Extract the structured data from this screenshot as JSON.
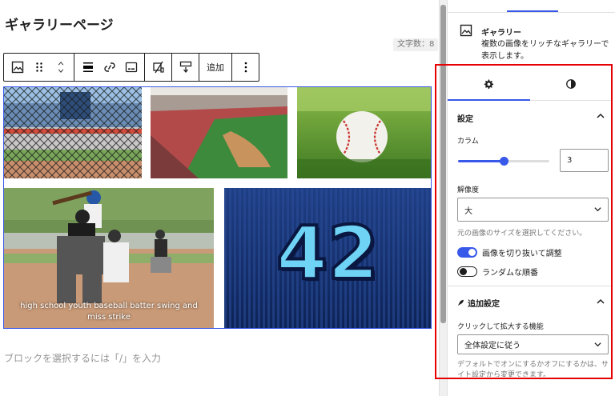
{
  "editor": {
    "page_title": "ギャラリーページ",
    "char_count": "文字数：8",
    "toolbar": {
      "add_label": "追加"
    },
    "gallery": {
      "caption": "high school youth baseball batter swing and miss strike",
      "number": "42"
    },
    "append_placeholder": "ブロックを選択するには「/」を入力"
  },
  "sidebar": {
    "block_card": {
      "title": "ギャラリー",
      "description": "複数の画像をリッチなギャラリーで表示します。"
    },
    "settings": {
      "heading": "設定",
      "columns_label": "カラム",
      "columns_value": "3",
      "columns_fraction": 0.5,
      "resolution_label": "解像度",
      "resolution_value": "大",
      "resolution_help": "元の画像のサイズを選択してください。",
      "crop_label": "画像を切り抜いて調整",
      "random_label": "ランダムな順番"
    },
    "additional": {
      "heading": "追加設定",
      "lightbox_label": "クリックして拡大する機能",
      "lightbox_value": "全体設定に従う",
      "lightbox_help": "デフォルトでオンにするかオフにするかは、サイト設定から変更できます。"
    }
  },
  "colors": {
    "accent": "#3858e9",
    "highlight_frame": "#e60000"
  },
  "icons": [
    "gallery-icon",
    "drag-icon",
    "move-up-icon",
    "move-down-icon",
    "align-icon",
    "link-icon",
    "caption-icon",
    "crop-icon",
    "text-overlay-icon",
    "more-icon",
    "settings-gear-icon",
    "styles-icon",
    "chevron-up-icon",
    "chevron-down-icon"
  ]
}
